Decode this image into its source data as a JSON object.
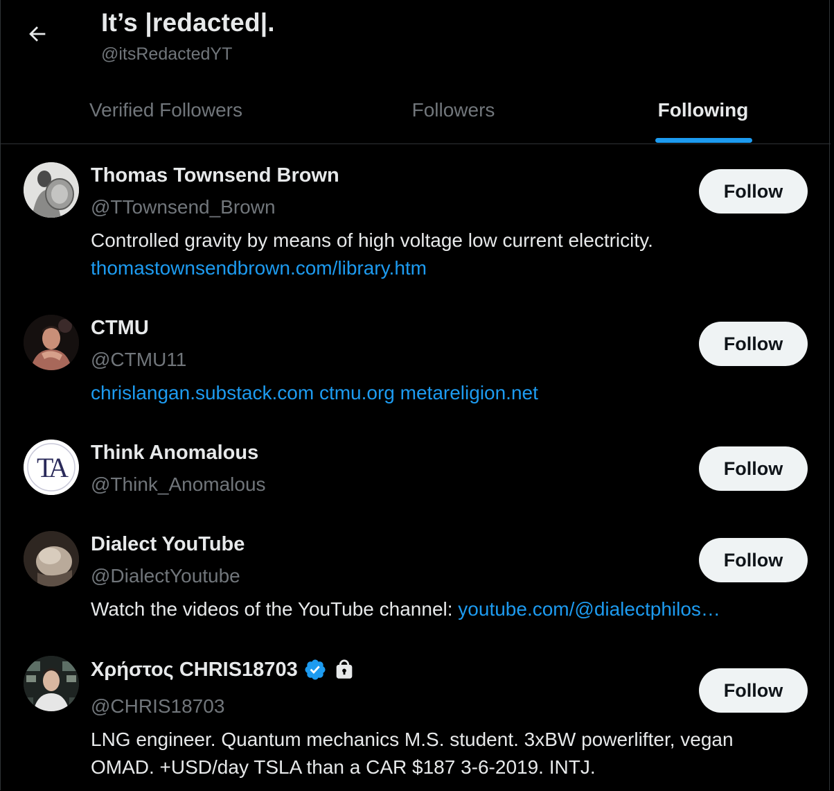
{
  "header": {
    "title": "It’s |redacted|.",
    "handle": "@itsRedactedYT"
  },
  "tabs": [
    {
      "label": "Verified Followers",
      "active": false
    },
    {
      "label": "Followers",
      "active": false
    },
    {
      "label": "Following",
      "active": true
    }
  ],
  "colors": {
    "background": "#000000",
    "text": "#e7e9ea",
    "muted": "#71767b",
    "accent": "#1d9bf0",
    "button_bg": "#eff3f4"
  },
  "users": [
    {
      "name": "Thomas Townsend Brown",
      "handle": "@TTownsend_Brown",
      "bio_text": "Controlled gravity by means of high voltage low current electricity.",
      "bio_link": "thomastownsendbrown.com/library.htm",
      "follow_label": "Follow",
      "avatar_icon": "bw-portrait-avatar"
    },
    {
      "name": "CTMU",
      "handle": "@CTMU11",
      "bio_links": [
        "chrislangan.substack.com",
        "ctmu.org",
        "metareligion.net"
      ],
      "follow_label": "Follow",
      "avatar_icon": "dark-portrait-avatar"
    },
    {
      "name": "Think Anomalous",
      "handle": "@Think_Anomalous",
      "follow_label": "Follow",
      "avatar_text": "TA"
    },
    {
      "name": "Dialect YouTube",
      "handle": "@DialectYoutube",
      "bio_text": "Watch the videos of the YouTube channel:",
      "bio_link": "youtube.com/@dialectphilos…",
      "follow_label": "Follow",
      "avatar_icon": "sculpture-avatar"
    },
    {
      "name": "Χρήστος CHRIS18703",
      "handle": "@CHRIS18703",
      "bio_line1": "LNG engineer. Quantum mechanics M.S. student. 3xBW powerlifter, vegan",
      "bio_line2": "OMAD. +USD/day TSLA than a CAR $187 3-6-2019. INTJ.",
      "follow_label": "Follow",
      "verified": true,
      "protected": true,
      "avatar_icon": "control-room-portrait-avatar"
    }
  ]
}
